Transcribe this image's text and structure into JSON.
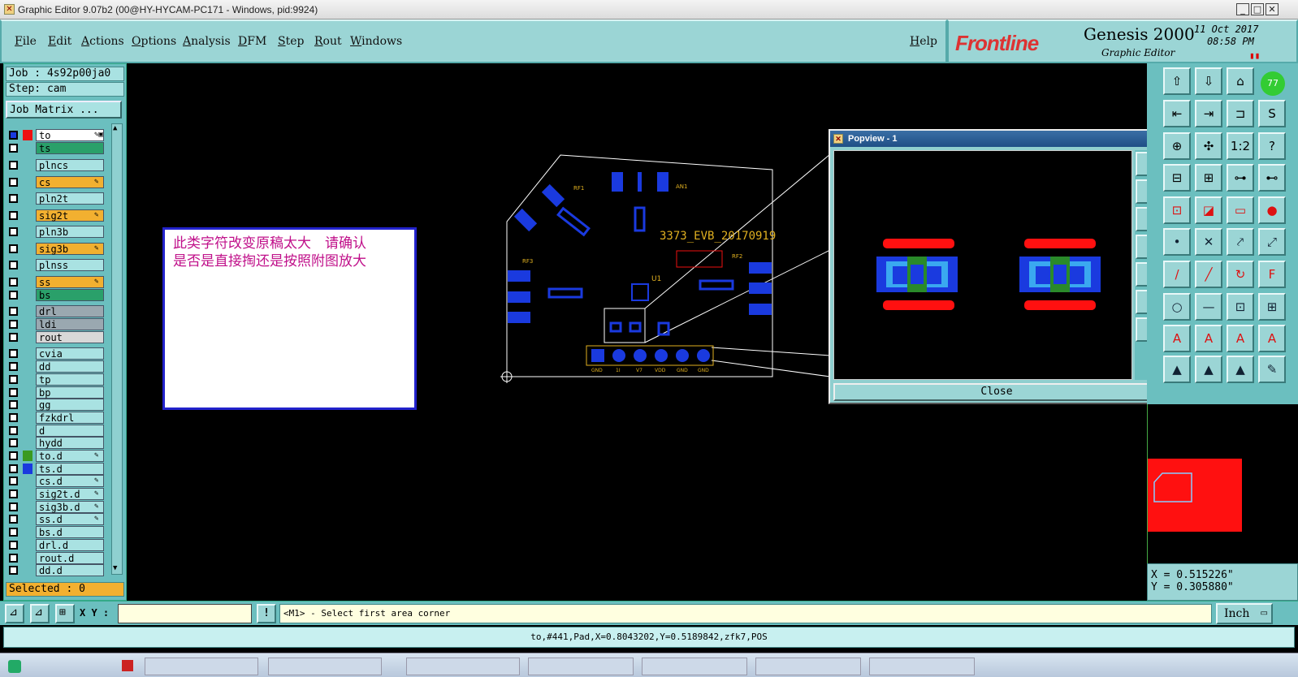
{
  "window": {
    "title": "Graphic Editor 9.07b2 (00@HY-HYCAM-PC171 - Windows, pid:9924)",
    "minimize": "_",
    "maximize": "□",
    "close": "✕"
  },
  "menu": {
    "items": [
      "File",
      "Edit",
      "Actions",
      "Options",
      "Analysis",
      "DFM",
      "Step",
      "Rout",
      "Windows"
    ],
    "help": "Help"
  },
  "brand": {
    "logo": "Frontline",
    "product": "Genesis 2000",
    "subtitle": "Graphic Editor",
    "date": "11 Oct 2017",
    "time": "08:58 PM",
    "badge": "77"
  },
  "job": {
    "job_label": "Job : 4s92p00ja0",
    "step_label": "Step: cam",
    "matrix_button": "Job Matrix ...",
    "selected": "Selected : 0"
  },
  "layers": [
    {
      "name": "to",
      "color": "#ffffff",
      "swatch": "#e11",
      "edit": "✎▣",
      "active": true
    },
    {
      "name": "ts",
      "color": "#2aa06a",
      "swatch": "",
      "edit": ""
    },
    {
      "name": "plncs",
      "color": "#a9e2e2",
      "swatch": "",
      "edit": ""
    },
    {
      "name": "cs",
      "color": "#f2b030",
      "swatch": "",
      "edit": "✎"
    },
    {
      "name": "pln2t",
      "color": "#a9e2e2",
      "swatch": "",
      "edit": ""
    },
    {
      "name": "sig2t",
      "color": "#f2b030",
      "swatch": "",
      "edit": "✎"
    },
    {
      "name": "pln3b",
      "color": "#a9e2e2",
      "swatch": "",
      "edit": ""
    },
    {
      "name": "sig3b",
      "color": "#f2b030",
      "swatch": "",
      "edit": "✎"
    },
    {
      "name": "plnss",
      "color": "#a9e2e2",
      "swatch": "",
      "edit": ""
    },
    {
      "name": "ss",
      "color": "#f2b030",
      "swatch": "",
      "edit": "✎"
    },
    {
      "name": "bs",
      "color": "#2aa06a",
      "swatch": "",
      "edit": ""
    },
    {
      "name": "drl",
      "color": "#9aa8b0",
      "swatch": "",
      "edit": ""
    },
    {
      "name": "ldi",
      "color": "#9aa8b0",
      "swatch": "",
      "edit": ""
    },
    {
      "name": "rout",
      "color": "#d8d8d8",
      "swatch": "",
      "edit": ""
    },
    {
      "name": "cvia",
      "color": "#a9e2e2",
      "swatch": "",
      "edit": ""
    },
    {
      "name": "dd",
      "color": "#a9e2e2",
      "swatch": "",
      "edit": ""
    },
    {
      "name": "tp",
      "color": "#a9e2e2",
      "swatch": "",
      "edit": ""
    },
    {
      "name": "bp",
      "color": "#a9e2e2",
      "swatch": "",
      "edit": ""
    },
    {
      "name": "gg",
      "color": "#a9e2e2",
      "swatch": "",
      "edit": ""
    },
    {
      "name": "fzkdrl",
      "color": "#a9e2e2",
      "swatch": "",
      "edit": ""
    },
    {
      "name": "d",
      "color": "#a9e2e2",
      "swatch": "",
      "edit": ""
    },
    {
      "name": "hydd",
      "color": "#a9e2e2",
      "swatch": "",
      "edit": ""
    },
    {
      "name": "to.d",
      "color": "#a9e2e2",
      "swatch": "#3a9a20",
      "edit": "✎"
    },
    {
      "name": "ts.d",
      "color": "#a9e2e2",
      "swatch": "#1a3adf",
      "edit": ""
    },
    {
      "name": "cs.d",
      "color": "#a9e2e2",
      "swatch": "",
      "edit": "✎"
    },
    {
      "name": "sig2t.d",
      "color": "#a9e2e2",
      "swatch": "",
      "edit": "✎"
    },
    {
      "name": "sig3b.d",
      "color": "#a9e2e2",
      "swatch": "",
      "edit": "✎"
    },
    {
      "name": "ss.d",
      "color": "#a9e2e2",
      "swatch": "",
      "edit": "✎"
    },
    {
      "name": "bs.d",
      "color": "#a9e2e2",
      "swatch": "",
      "edit": ""
    },
    {
      "name": "drl.d",
      "color": "#a9e2e2",
      "swatch": "",
      "edit": ""
    },
    {
      "name": "rout.d",
      "color": "#a9e2e2",
      "swatch": "",
      "edit": ""
    },
    {
      "name": "dd.d",
      "color": "#a9e2e2",
      "swatch": "",
      "edit": ""
    }
  ],
  "board": {
    "label": "3373_EVB_20170919",
    "refs": [
      "RF1",
      "AN1",
      "RF3",
      "RF2",
      "U1"
    ],
    "pins": [
      "GND",
      "1I",
      "V7",
      "VDD",
      "GND",
      "GND"
    ]
  },
  "note": {
    "line1": "此类字符改变原稿太大　请确认",
    "line2": "是否是直接掏还是按照附图放大"
  },
  "popview": {
    "title": "Popview - 1",
    "close_label": "Close"
  },
  "coords": {
    "x": "X = 0.515226\"",
    "y": "Y = 0.305880\""
  },
  "command": {
    "xy_label": "X Y :",
    "xy_value": "",
    "warn": "!",
    "prompt": "<M1> - Select first area corner",
    "units": "Inch"
  },
  "status": "to,#441,Pad,X=0.8043202,Y=0.5189842,zfk7,POS",
  "colors": {
    "panel": "#6bbfbf",
    "menu": "#9bd5d5",
    "pad_blue": "#1a3adf",
    "pad_red": "#ff1010",
    "text_yellow": "#e0b020"
  }
}
